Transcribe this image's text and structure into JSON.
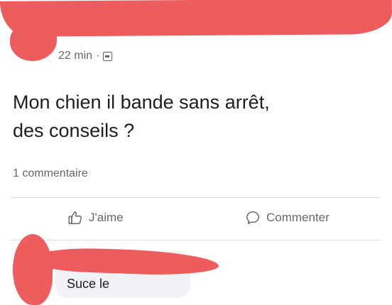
{
  "post": {
    "time": "22 min",
    "separator": "·",
    "text_line1": "Mon chien il bande sans arrêt,",
    "text_line2": "des conseils ?",
    "comment_count": "1 commentaire"
  },
  "actions": {
    "like_label": "J'aime",
    "comment_label": "Commenter"
  },
  "comment": {
    "text": "Suce le"
  },
  "colors": {
    "redaction": "#ee5d5d",
    "secondary_text": "#65676b",
    "bubble": "#f0f2f5"
  },
  "icons": {
    "privacy": "globe-icon",
    "like": "thumbs-up-icon",
    "comment": "speech-bubble-icon"
  }
}
